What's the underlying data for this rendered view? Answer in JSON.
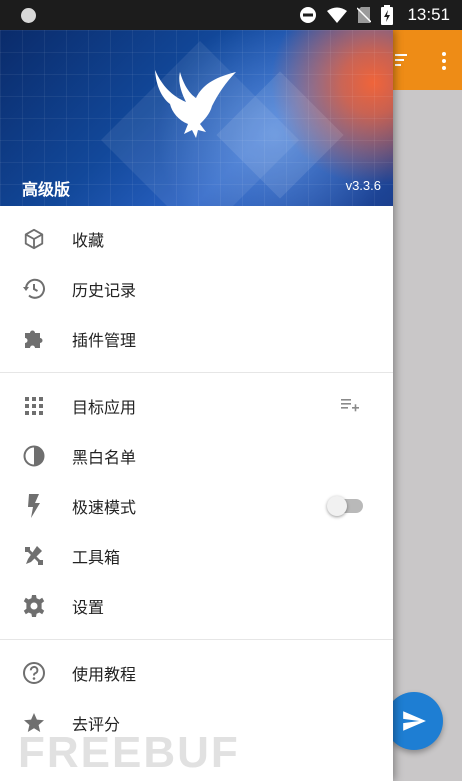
{
  "status_bar": {
    "time": "13:51"
  },
  "drawer": {
    "edition": "高级版",
    "version": "v3.3.6",
    "group1": [
      {
        "label": "收藏",
        "icon": "cube-icon"
      },
      {
        "label": "历史记录",
        "icon": "history-icon"
      },
      {
        "label": "插件管理",
        "icon": "puzzle-icon"
      }
    ],
    "group2": [
      {
        "label": "目标应用",
        "icon": "apps-grid-icon",
        "trail": "playlist-add-icon"
      },
      {
        "label": "黑白名单",
        "icon": "contrast-icon"
      },
      {
        "label": "极速模式",
        "icon": "lightning-icon",
        "toggle": false
      },
      {
        "label": "工具箱",
        "icon": "tools-icon"
      },
      {
        "label": "设置",
        "icon": "gear-icon"
      }
    ],
    "group3": [
      {
        "label": "使用教程",
        "icon": "help-icon"
      },
      {
        "label": "去评分",
        "icon": "star-icon"
      }
    ]
  },
  "watermark": "FREEBUF",
  "colors": {
    "appbar": "#ee8c16",
    "fab": "#1e7ed3",
    "icon": "#6f6f6f"
  }
}
